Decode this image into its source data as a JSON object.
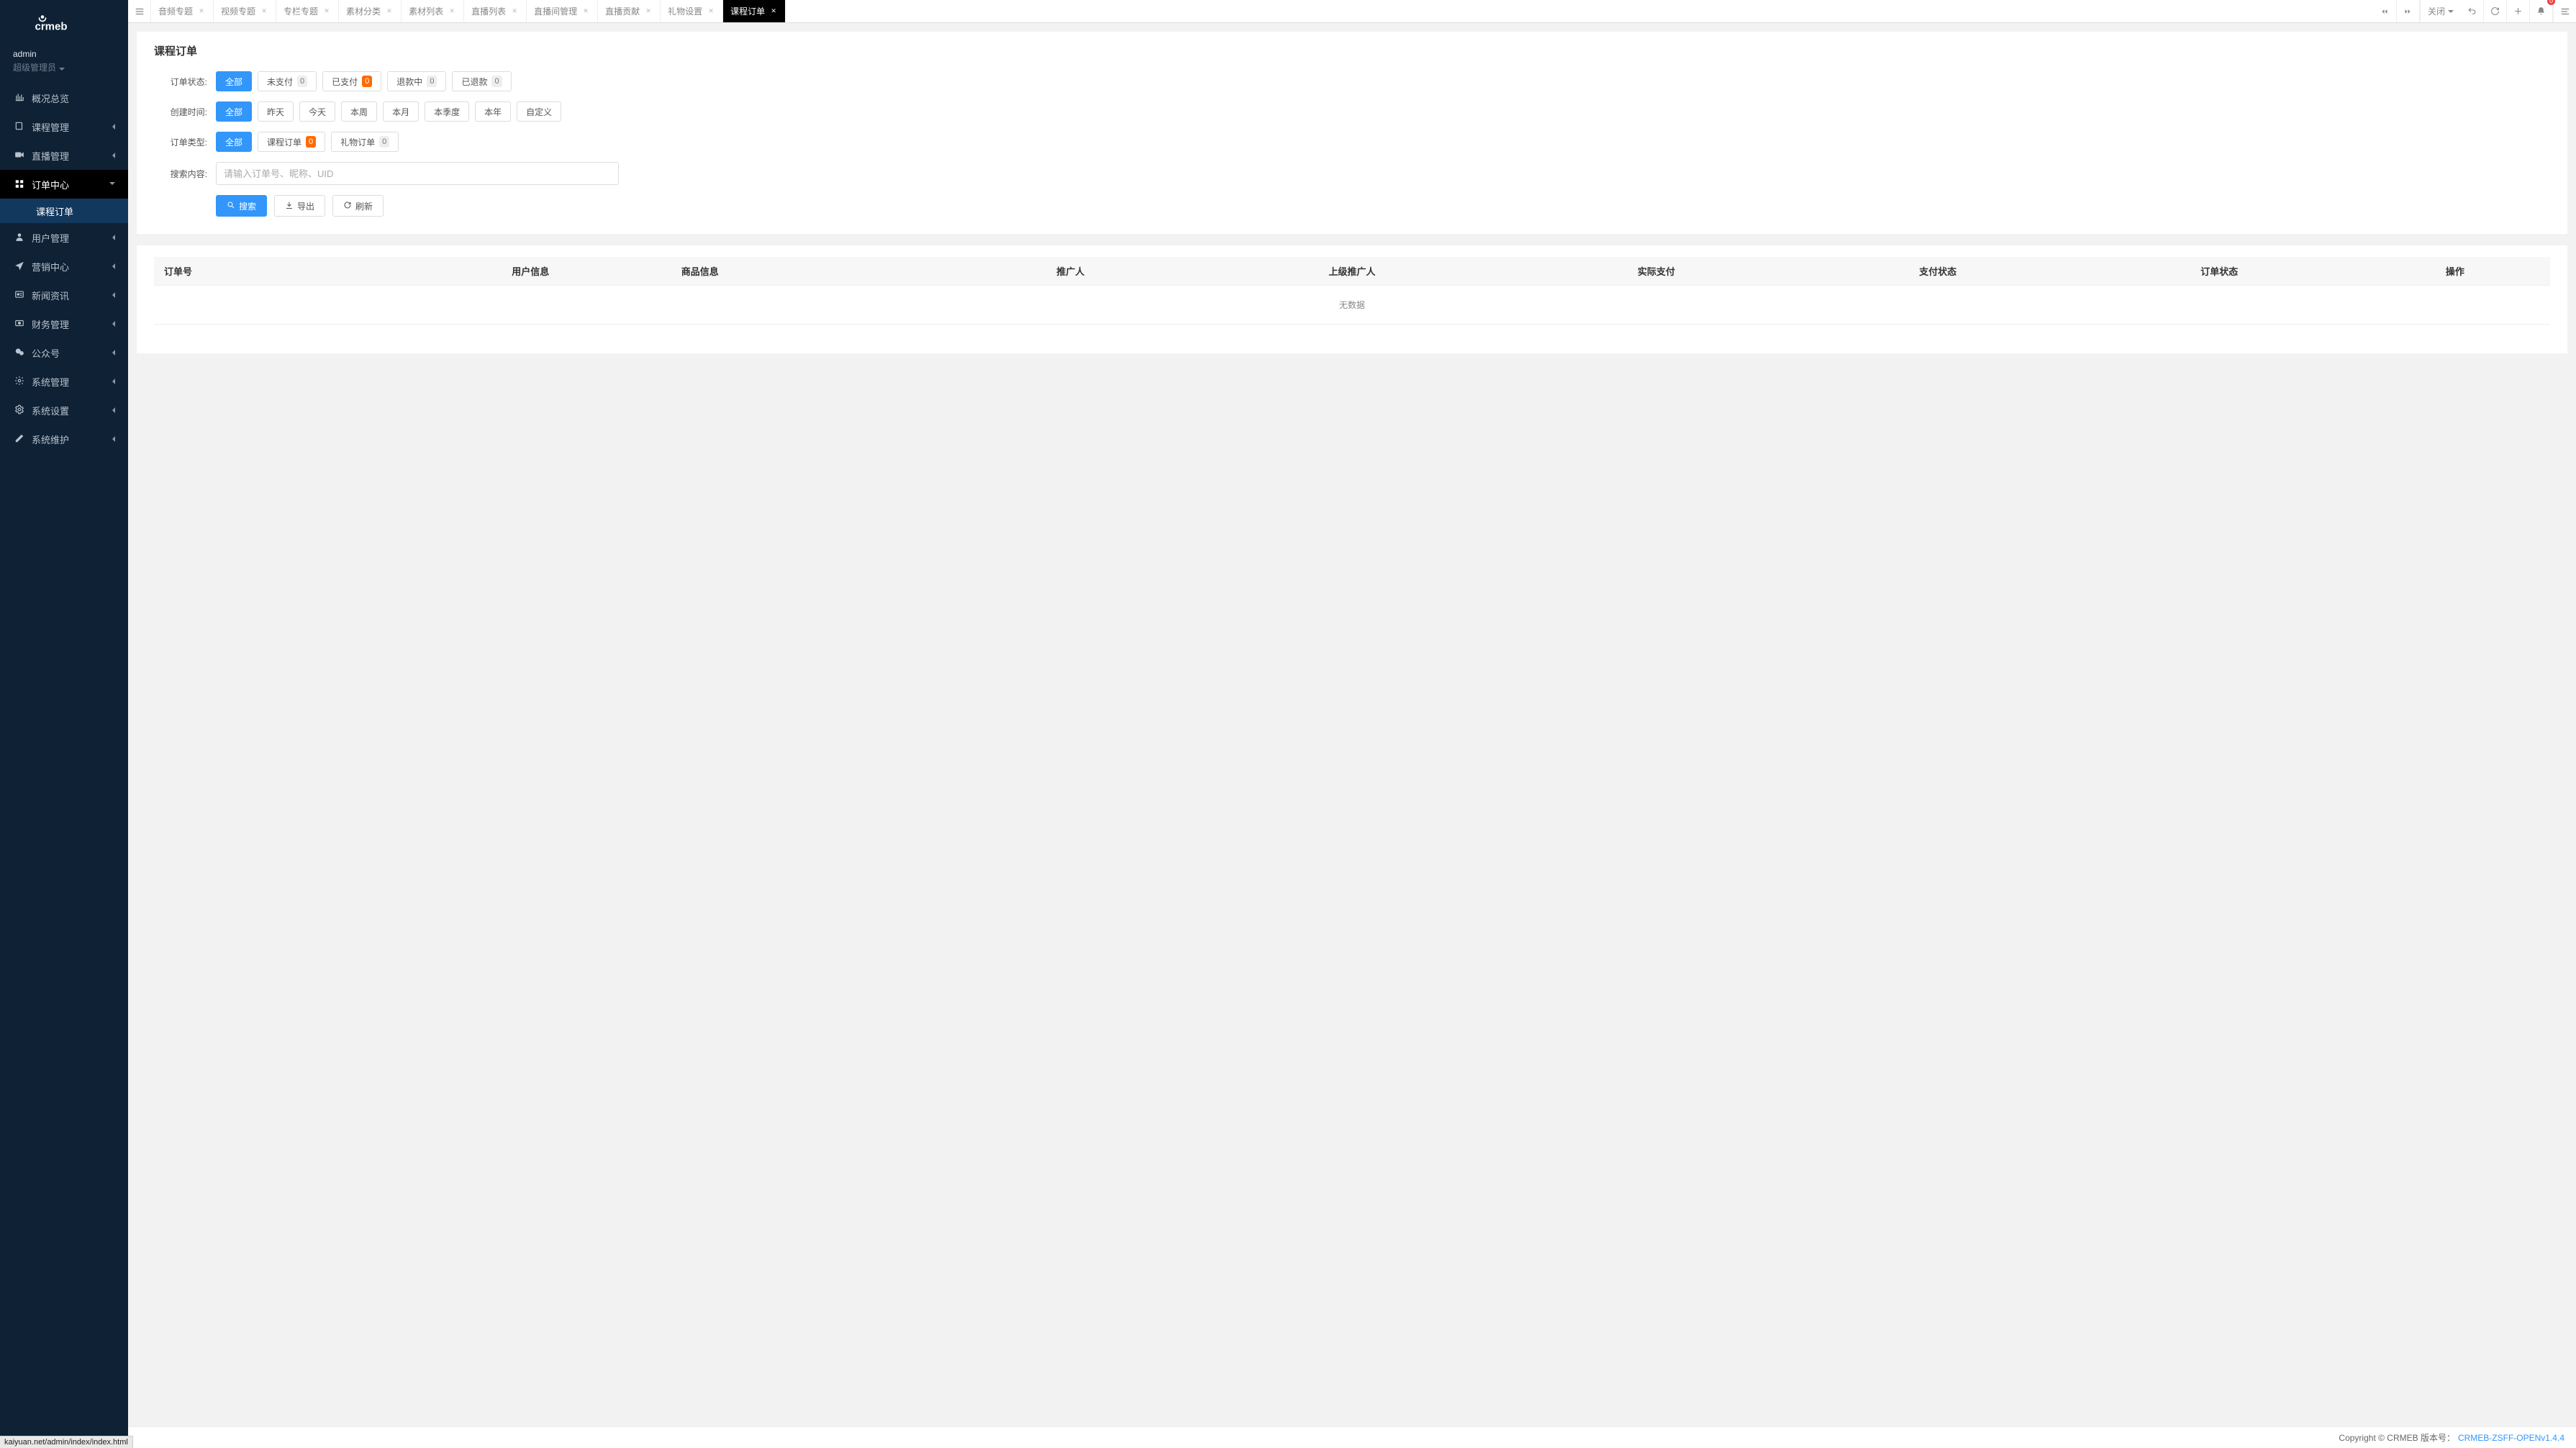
{
  "brand": {
    "name": "crmeb"
  },
  "user": {
    "name": "admin",
    "role": "超级管理员"
  },
  "sidebar": {
    "items": [
      {
        "label": "概况总览",
        "icon": "overview-icon",
        "has_children": false
      },
      {
        "label": "课程管理",
        "icon": "course-icon",
        "has_children": true
      },
      {
        "label": "直播管理",
        "icon": "live-icon",
        "has_children": true
      },
      {
        "label": "订单中心",
        "icon": "order-icon",
        "has_children": true,
        "expanded": true,
        "children": [
          {
            "label": "课程订单",
            "active": true
          }
        ]
      },
      {
        "label": "用户管理",
        "icon": "user-icon",
        "has_children": true
      },
      {
        "label": "营销中心",
        "icon": "marketing-icon",
        "has_children": true
      },
      {
        "label": "新闻资讯",
        "icon": "news-icon",
        "has_children": true
      },
      {
        "label": "财务管理",
        "icon": "finance-icon",
        "has_children": true
      },
      {
        "label": "公众号",
        "icon": "wechat-icon",
        "has_children": true
      },
      {
        "label": "系统管理",
        "icon": "system-icon",
        "has_children": true
      },
      {
        "label": "系统设置",
        "icon": "settings-icon",
        "has_children": true
      },
      {
        "label": "系统维护",
        "icon": "maintain-icon",
        "has_children": true
      }
    ]
  },
  "topbar": {
    "tabs": [
      {
        "label": "音频专题"
      },
      {
        "label": "视频专题"
      },
      {
        "label": "专栏专题"
      },
      {
        "label": "素材分类"
      },
      {
        "label": "素材列表"
      },
      {
        "label": "直播列表"
      },
      {
        "label": "直播间管理"
      },
      {
        "label": "直播贡献"
      },
      {
        "label": "礼物设置"
      },
      {
        "label": "课程订单",
        "active": true
      }
    ],
    "close_dropdown_label": "关闭",
    "notification_count": "0"
  },
  "page": {
    "title": "课程订单"
  },
  "filters": {
    "labels": {
      "order_status": "订单状态:",
      "created_at": "创建时间:",
      "order_type": "订单类型:",
      "search": "搜索内容:"
    },
    "order_status": {
      "all_label": "全部",
      "options": [
        {
          "label": "未支付",
          "count": "0"
        },
        {
          "label": "已支付",
          "count": "0",
          "count_style": "orange"
        },
        {
          "label": "退款中",
          "count": "0"
        },
        {
          "label": "已退款",
          "count": "0"
        }
      ]
    },
    "created_at": {
      "all_label": "全部",
      "options": [
        "昨天",
        "今天",
        "本周",
        "本月",
        "本季度",
        "本年",
        "自定义"
      ]
    },
    "order_type": {
      "all_label": "全部",
      "options": [
        {
          "label": "课程订单",
          "count": "0",
          "count_style": "orange"
        },
        {
          "label": "礼物订单",
          "count": "0"
        }
      ]
    },
    "search_placeholder": "请输入订单号、昵称、UID",
    "actions": {
      "search": "搜索",
      "export": "导出",
      "refresh": "刷新"
    }
  },
  "table": {
    "columns": [
      "订单号",
      "用户信息",
      "商品信息",
      "推广人",
      "上级推广人",
      "实际支付",
      "支付状态",
      "订单状态",
      "操作"
    ],
    "empty": "无数据"
  },
  "footer": {
    "copyright": "Copyright © CRMEB 版本号：",
    "version": "CRMEB-ZSFF-OPENv1.4.4"
  },
  "status_hint": "kaiyuan.net/admin/index/index.html"
}
